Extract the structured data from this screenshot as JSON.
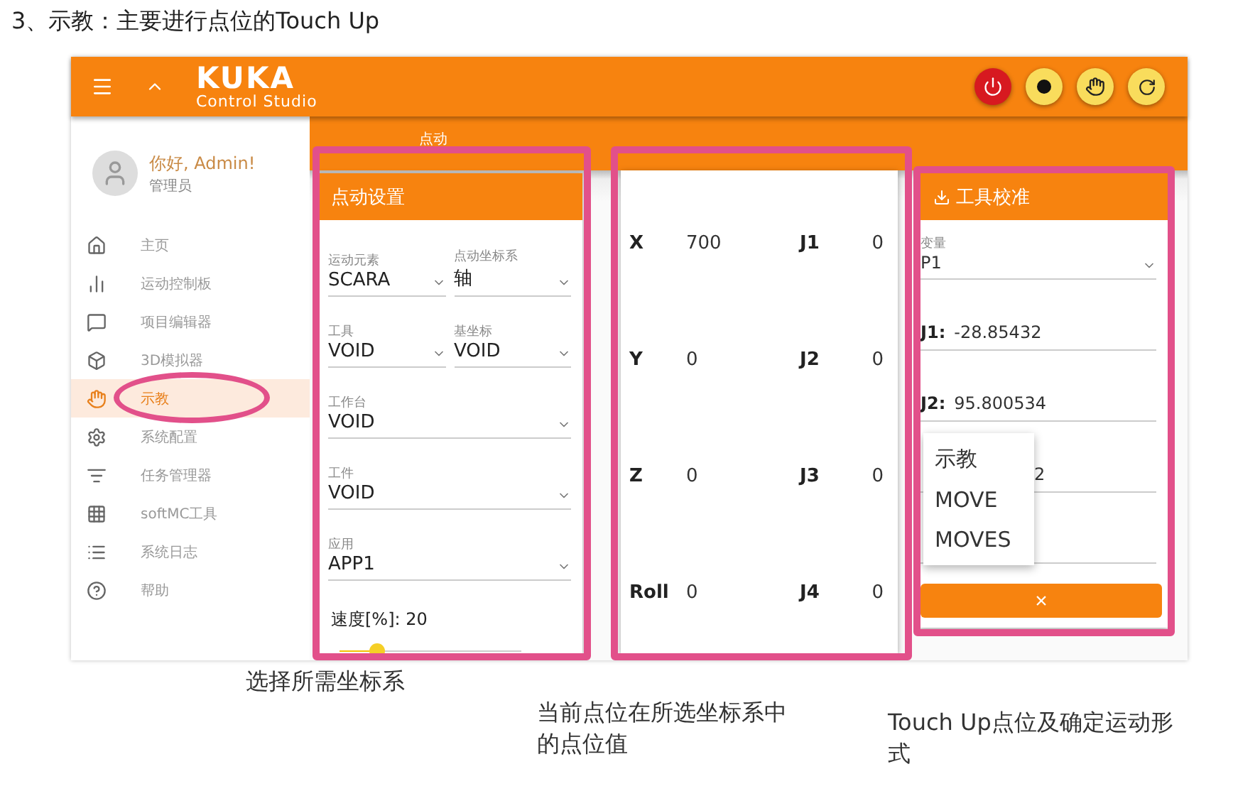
{
  "heading": "3、示教：主要进行点位的Touch Up",
  "header": {
    "logo_top": "KUKA",
    "logo_bottom": "Control Studio",
    "buttons": [
      {
        "kind": "power"
      },
      {
        "kind": "record"
      },
      {
        "kind": "teach"
      },
      {
        "kind": "refresh"
      }
    ]
  },
  "user": {
    "greeting": "你好, Admin!",
    "role": "管理员"
  },
  "sidebar": {
    "items": [
      {
        "label": "主页",
        "selected": false
      },
      {
        "label": "运动控制板",
        "selected": false
      },
      {
        "label": "项目编辑器",
        "selected": false
      },
      {
        "label": "3D模拟器",
        "selected": false
      },
      {
        "label": "示教",
        "selected": true
      },
      {
        "label": "系统配置",
        "selected": false
      },
      {
        "label": "任务管理器",
        "selected": false
      },
      {
        "label": "softMC工具",
        "selected": false
      },
      {
        "label": "系统日志",
        "selected": false
      },
      {
        "label": "帮助",
        "selected": false
      }
    ]
  },
  "tab": "点动",
  "jog_settings": {
    "title": "点动设置",
    "rows": [
      [
        {
          "label": "运动元素",
          "value": "SCARA"
        },
        {
          "label": "点动坐标系",
          "value": "轴"
        }
      ],
      [
        {
          "label": "工具",
          "value": "VOID"
        },
        {
          "label": "基坐标",
          "value": "VOID"
        }
      ],
      [
        {
          "label": "工作台",
          "value": "VOID"
        }
      ],
      [
        {
          "label": "工件",
          "value": "VOID"
        }
      ],
      [
        {
          "label": "应用",
          "value": "APP1"
        }
      ]
    ],
    "speed": {
      "label": "速度[%]: 20",
      "level": 0.2
    }
  },
  "positions": [
    {
      "axis": "X",
      "value": "700",
      "joint": "J1",
      "joint_value": "0"
    },
    {
      "axis": "Y",
      "value": "0",
      "joint": "J2",
      "joint_value": "0"
    },
    {
      "axis": "Z",
      "value": "0",
      "joint": "J3",
      "joint_value": "0"
    },
    {
      "axis": "Roll",
      "value": "0",
      "joint": "J4",
      "joint_value": "0"
    }
  ],
  "tool_calibration": {
    "title": "工具校准",
    "variable": {
      "label": "变量",
      "value": "P1"
    },
    "fields": [
      {
        "label": "J1:",
        "value": "-28.85432"
      },
      {
        "label": "J2:",
        "value": "95.800534"
      },
      {
        "value": "2"
      }
    ],
    "menu": [
      "示教",
      "MOVE",
      "MOVES"
    ],
    "button": "×"
  },
  "captions": [
    "选择所需坐标系",
    "当前点位在所选坐标系中的点位值",
    "Touch Up点位及确定运动形式"
  ]
}
